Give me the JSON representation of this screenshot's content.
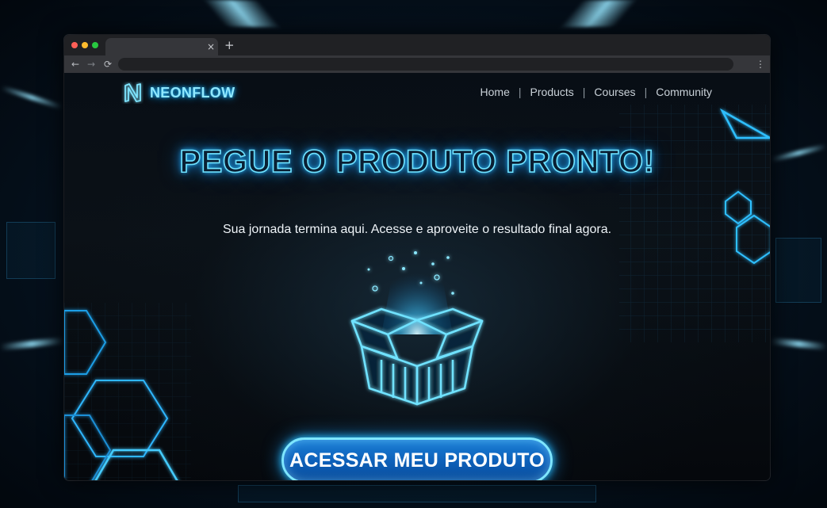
{
  "browser": {
    "tab_close": "×",
    "new_tab": "+",
    "back": "←",
    "forward": "→",
    "reload": "⟳",
    "address": "",
    "menu": "⋮"
  },
  "header": {
    "brand": "NEONFLOW",
    "nav": [
      {
        "label": "Home"
      },
      {
        "label": "Products"
      },
      {
        "label": "Courses"
      },
      {
        "label": "Community"
      }
    ],
    "separator": "|"
  },
  "hero": {
    "title": "PEGUE O PRODUTO PRONTO!",
    "subtitle": "Sua jornada termina aqui. Acesse e aproveite o resultado final agora.",
    "cta_label": "ACESSAR MEU PRODUTO"
  },
  "theme": {
    "accent": "#29B9FF",
    "neon_cyan": "#6FE2FF",
    "button_fill": "#0D5FB8",
    "page_bg": "#080E15"
  },
  "icons": {
    "logo": "logo-n-icon",
    "box": "open-box-icon",
    "decor": "hexagon-icon"
  }
}
